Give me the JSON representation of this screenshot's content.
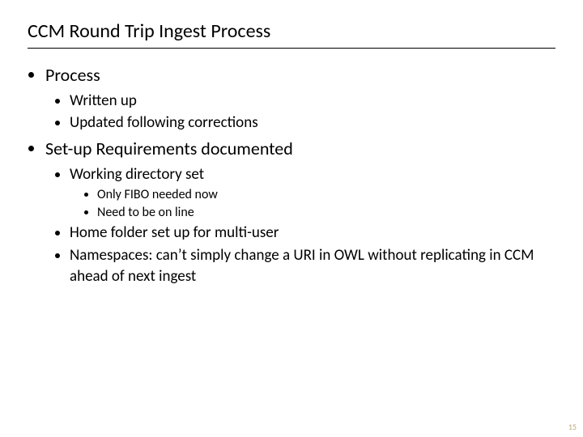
{
  "title": "CCM Round Trip Ingest Process",
  "b1": "Process",
  "b1_1": "Written up",
  "b1_2": "Updated following corrections",
  "b2": "Set-up Requirements documented",
  "b2_1": "Working directory set",
  "b2_1_1": "Only FIBO needed now",
  "b2_1_2": "Need to be on line",
  "b2_2": "Home folder set up for multi-user",
  "b2_3": "Namespaces: can’t simply change a URI in OWL without replicating in CCM ahead of next ingest",
  "page_number": "15"
}
